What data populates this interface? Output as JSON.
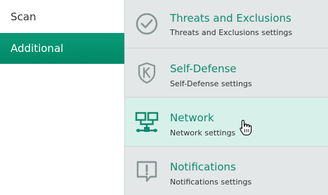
{
  "sidebar": {
    "items": [
      {
        "label": "Scan"
      },
      {
        "label": "Additional"
      }
    ]
  },
  "panel": {
    "items": [
      {
        "title": "Threats and Exclusions",
        "subtitle": "Threats and Exclusions settings",
        "icon": "check-circle-icon"
      },
      {
        "title": "Self-Defense",
        "subtitle": "Self-Defense settings",
        "icon": "shield-k-icon"
      },
      {
        "title": "Network",
        "subtitle": "Network settings",
        "icon": "network-icon"
      },
      {
        "title": "Notifications",
        "subtitle": "Notifications settings",
        "icon": "exclamation-bubble-icon"
      }
    ]
  },
  "colors": {
    "accent": "#008866",
    "title_text": "#118a6e",
    "panel_bg": "#e3e7e7",
    "hover_bg": "#d7f1ea"
  }
}
